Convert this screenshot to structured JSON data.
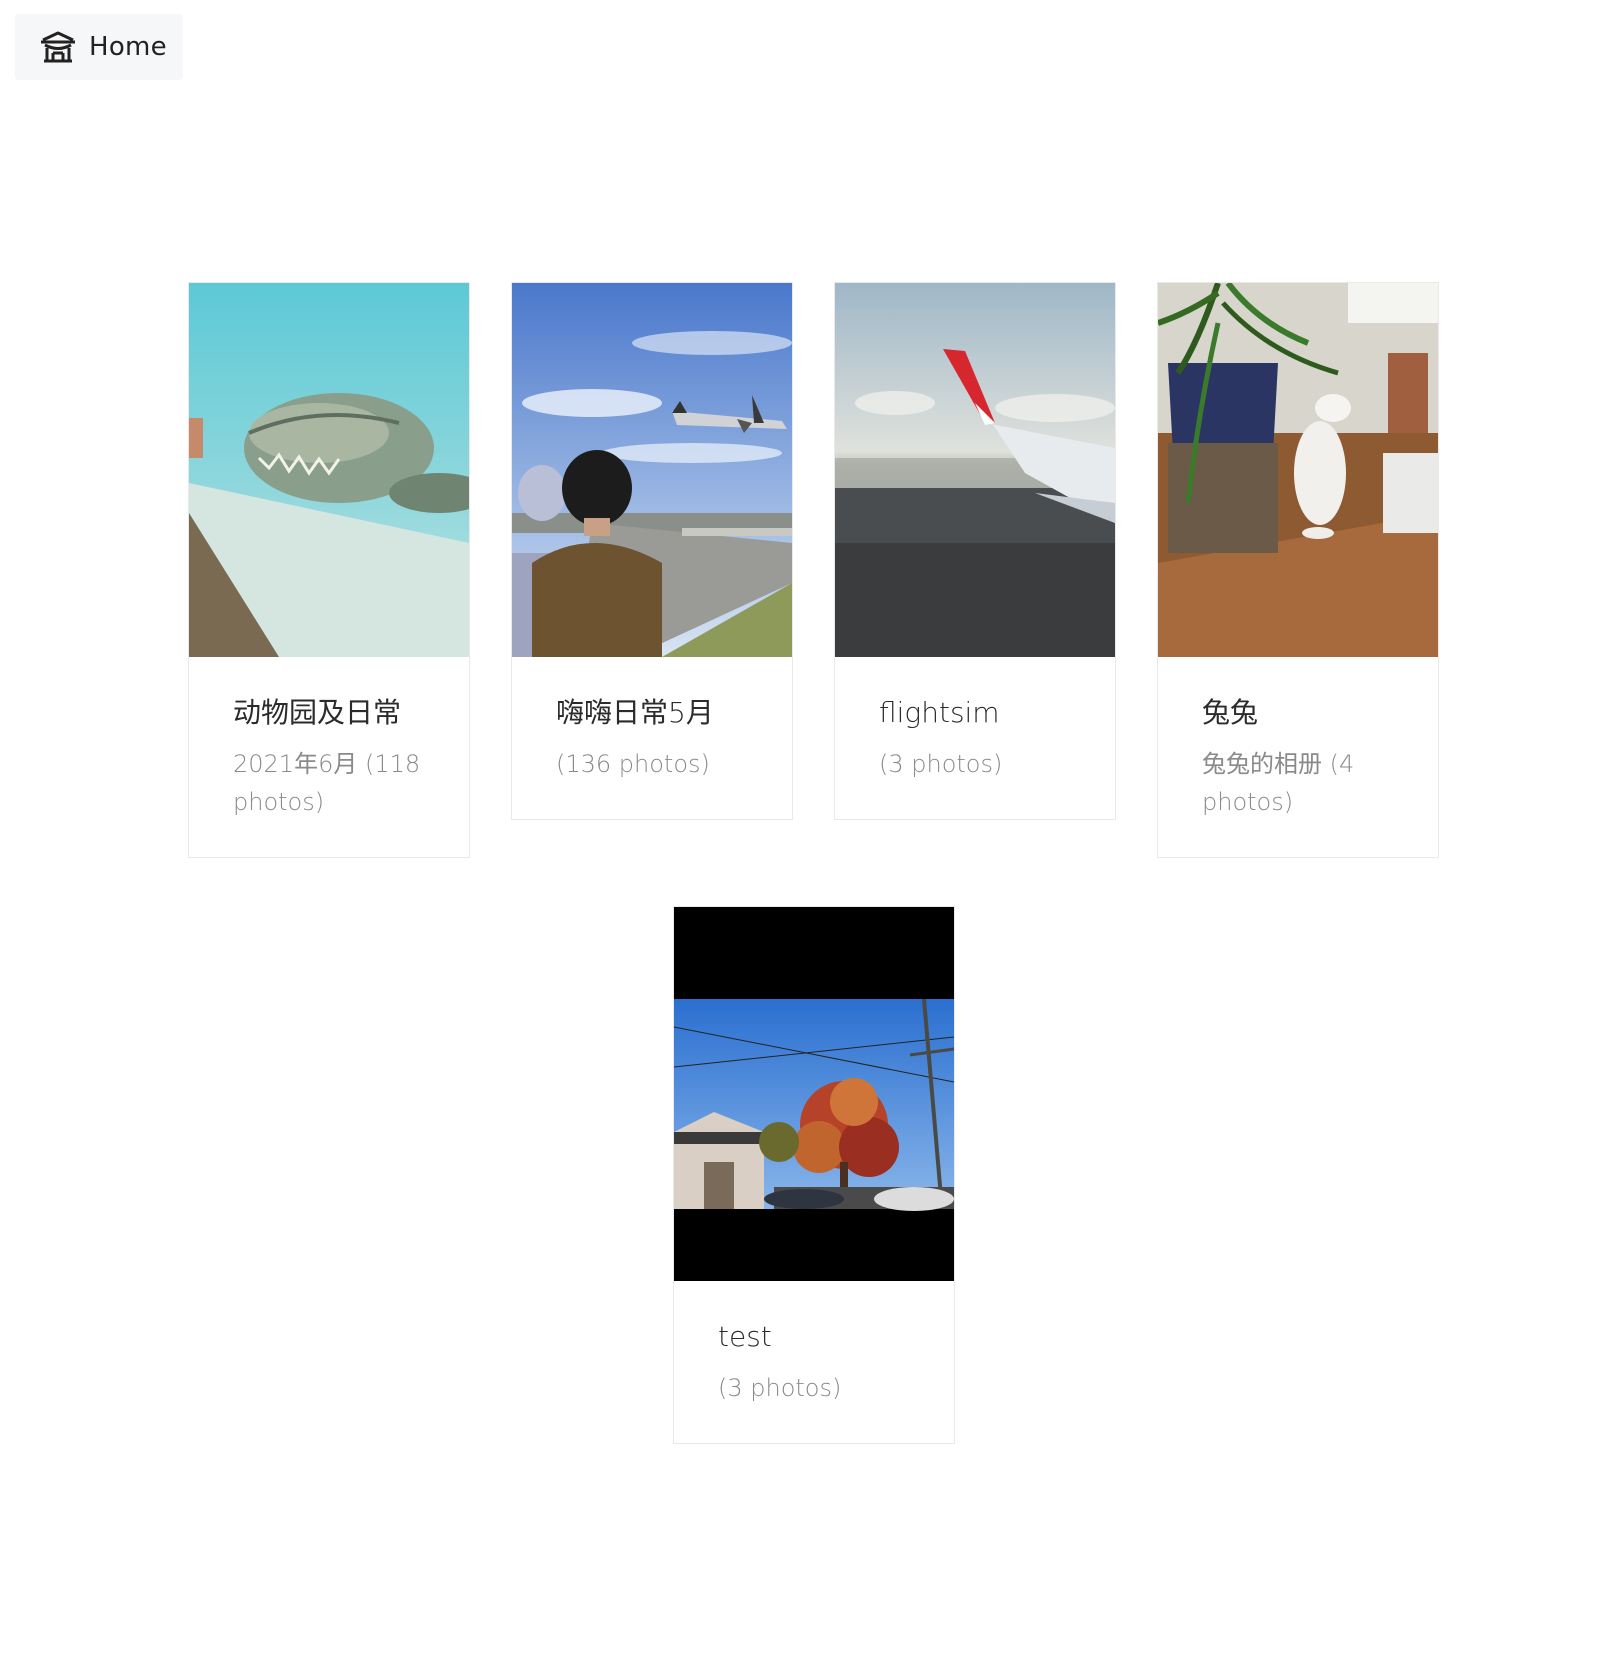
{
  "nav": {
    "home_label": "Home",
    "home_icon": "storefront-icon"
  },
  "albums": [
    {
      "title": "动物园及日常",
      "subtitle": "2021年6月 (118 photos)",
      "cover": "crocodile-underwater-photo"
    },
    {
      "title": "嗨嗨日常5月",
      "subtitle": "(136 photos)",
      "cover": "airplane-over-spectators-photo"
    },
    {
      "title": "flightsim",
      "subtitle": "(3 photos)",
      "cover": "aircraft-wing-over-city-photo"
    },
    {
      "title": "兔兔",
      "subtitle": "兔兔的相册 (4 photos)",
      "cover": "rabbit-by-plant-photo"
    },
    {
      "title": "test",
      "subtitle": "(3 photos)",
      "cover": "autumn-tree-street-photo"
    }
  ]
}
